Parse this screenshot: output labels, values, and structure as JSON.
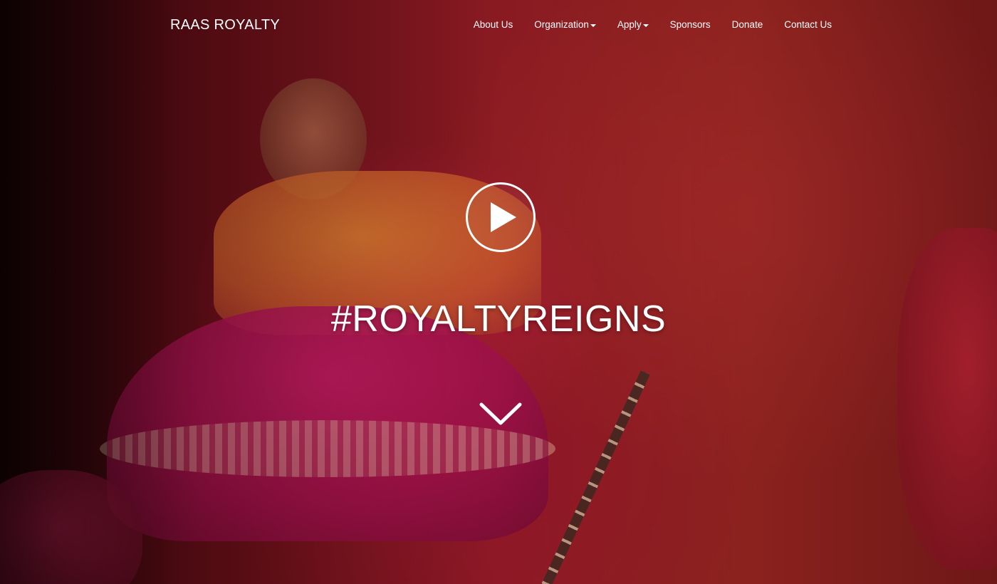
{
  "brand": {
    "name": "RAAS ROYALTY"
  },
  "nav": {
    "items": [
      {
        "label": "About Us",
        "dropdown": false
      },
      {
        "label": "Organization",
        "dropdown": true
      },
      {
        "label": "Apply",
        "dropdown": true
      },
      {
        "label": "Sponsors",
        "dropdown": false
      },
      {
        "label": "Donate",
        "dropdown": false
      },
      {
        "label": "Contact Us",
        "dropdown": false
      }
    ]
  },
  "hero": {
    "headline": "#ROYALTYREIGNS",
    "play_icon": "play-circle-icon",
    "scroll_icon": "chevron-down-icon"
  },
  "colors": {
    "text": "#ffffff",
    "overlay_red": "#8a1a22",
    "dress_pink": "#c01a63"
  }
}
